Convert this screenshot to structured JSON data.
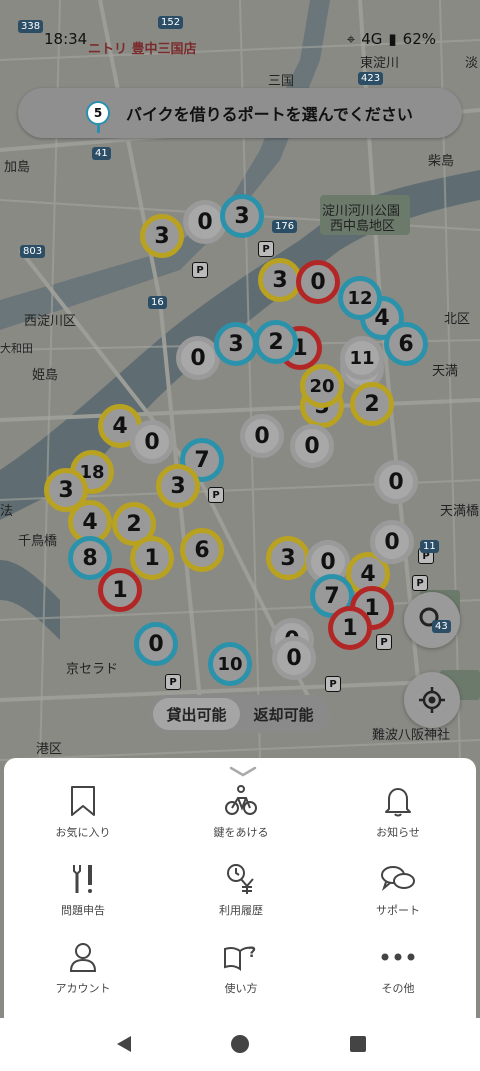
{
  "status": {
    "time": "18:34",
    "signal": "4G",
    "battery": "62%"
  },
  "banner": {
    "step": "5",
    "text": "バイクを借りるポートを選んでください"
  },
  "map_labels": [
    {
      "text": "ニトリ 豊中三国店"
    },
    {
      "text": "三国"
    },
    {
      "text": "東淀川"
    },
    {
      "text": "淡"
    },
    {
      "text": "加島"
    },
    {
      "text": "柴島"
    },
    {
      "text": "淀川河川公園"
    },
    {
      "text": "西中島地区"
    },
    {
      "text": "西淀川区"
    },
    {
      "text": "北区"
    },
    {
      "text": "大和田"
    },
    {
      "text": "姫島"
    },
    {
      "text": "天満"
    },
    {
      "text": "千鳥橋"
    },
    {
      "text": "天満橋"
    },
    {
      "text": "京セラド"
    },
    {
      "text": "港区"
    },
    {
      "text": "難波八阪神社"
    },
    {
      "text": "法"
    }
  ],
  "road_numbers": [
    "338",
    "152",
    "423",
    "41",
    "176",
    "803",
    "16",
    "11",
    "43",
    "2"
  ],
  "markers": [
    {
      "n": "3",
      "c": "yellow"
    },
    {
      "n": "0",
      "c": "gray"
    },
    {
      "n": "3",
      "c": "blue"
    },
    {
      "n": "3",
      "c": "yellow"
    },
    {
      "n": "0",
      "c": "red"
    },
    {
      "n": "4",
      "c": "blue"
    },
    {
      "n": "6",
      "c": "blue"
    },
    {
      "n": "0",
      "c": "gray"
    },
    {
      "n": "3",
      "c": "blue"
    },
    {
      "n": "1",
      "c": "red"
    },
    {
      "n": "2",
      "c": "blue"
    },
    {
      "n": "1",
      "c": "gray"
    },
    {
      "n": "4",
      "c": "yellow"
    },
    {
      "n": "0",
      "c": "gray"
    },
    {
      "n": "7",
      "c": "blue"
    },
    {
      "n": "5",
      "c": "yellow"
    },
    {
      "n": "2",
      "c": "yellow"
    },
    {
      "n": "0",
      "c": "gray"
    },
    {
      "n": "0",
      "c": "gray"
    },
    {
      "n": "18",
      "c": "yellow"
    },
    {
      "n": "3",
      "c": "yellow"
    },
    {
      "n": "3",
      "c": "yellow"
    },
    {
      "n": "4",
      "c": "yellow"
    },
    {
      "n": "2",
      "c": "yellow"
    },
    {
      "n": "0",
      "c": "gray"
    },
    {
      "n": "8",
      "c": "blue"
    },
    {
      "n": "1",
      "c": "yellow"
    },
    {
      "n": "6",
      "c": "yellow"
    },
    {
      "n": "3",
      "c": "yellow"
    },
    {
      "n": "0",
      "c": "gray"
    },
    {
      "n": "4",
      "c": "yellow"
    },
    {
      "n": "1",
      "c": "red"
    },
    {
      "n": "7",
      "c": "blue"
    },
    {
      "n": "1",
      "c": "red"
    },
    {
      "n": "1",
      "c": "red"
    },
    {
      "n": "0",
      "c": "gray"
    },
    {
      "n": "0",
      "c": "blue"
    },
    {
      "n": "10",
      "c": "blue"
    },
    {
      "n": "0",
      "c": "gray"
    },
    {
      "n": "0",
      "c": "gray"
    },
    {
      "n": "12",
      "c": "blue"
    },
    {
      "n": "20",
      "c": "yellow"
    },
    {
      "n": "11",
      "c": "gray"
    }
  ],
  "toggle": {
    "rent": "貸出可能",
    "return": "返却可能"
  },
  "menu": [
    {
      "label": "お気に入り",
      "icon": "bookmark-icon"
    },
    {
      "label": "鍵をあける",
      "icon": "bike-unlock-icon"
    },
    {
      "label": "お知らせ",
      "icon": "bell-icon"
    },
    {
      "label": "問題申告",
      "icon": "tools-icon"
    },
    {
      "label": "利用履歴",
      "icon": "history-yen-icon"
    },
    {
      "label": "サポート",
      "icon": "chat-bubbles-icon"
    },
    {
      "label": "アカウント",
      "icon": "person-icon"
    },
    {
      "label": "使い方",
      "icon": "book-question-icon"
    },
    {
      "label": "その他",
      "icon": "more-dots-icon"
    }
  ],
  "colors": {
    "yellow": "#b8a21f",
    "blue": "#2a92aa",
    "red": "#b32626",
    "gray": "#9a9a9a"
  }
}
